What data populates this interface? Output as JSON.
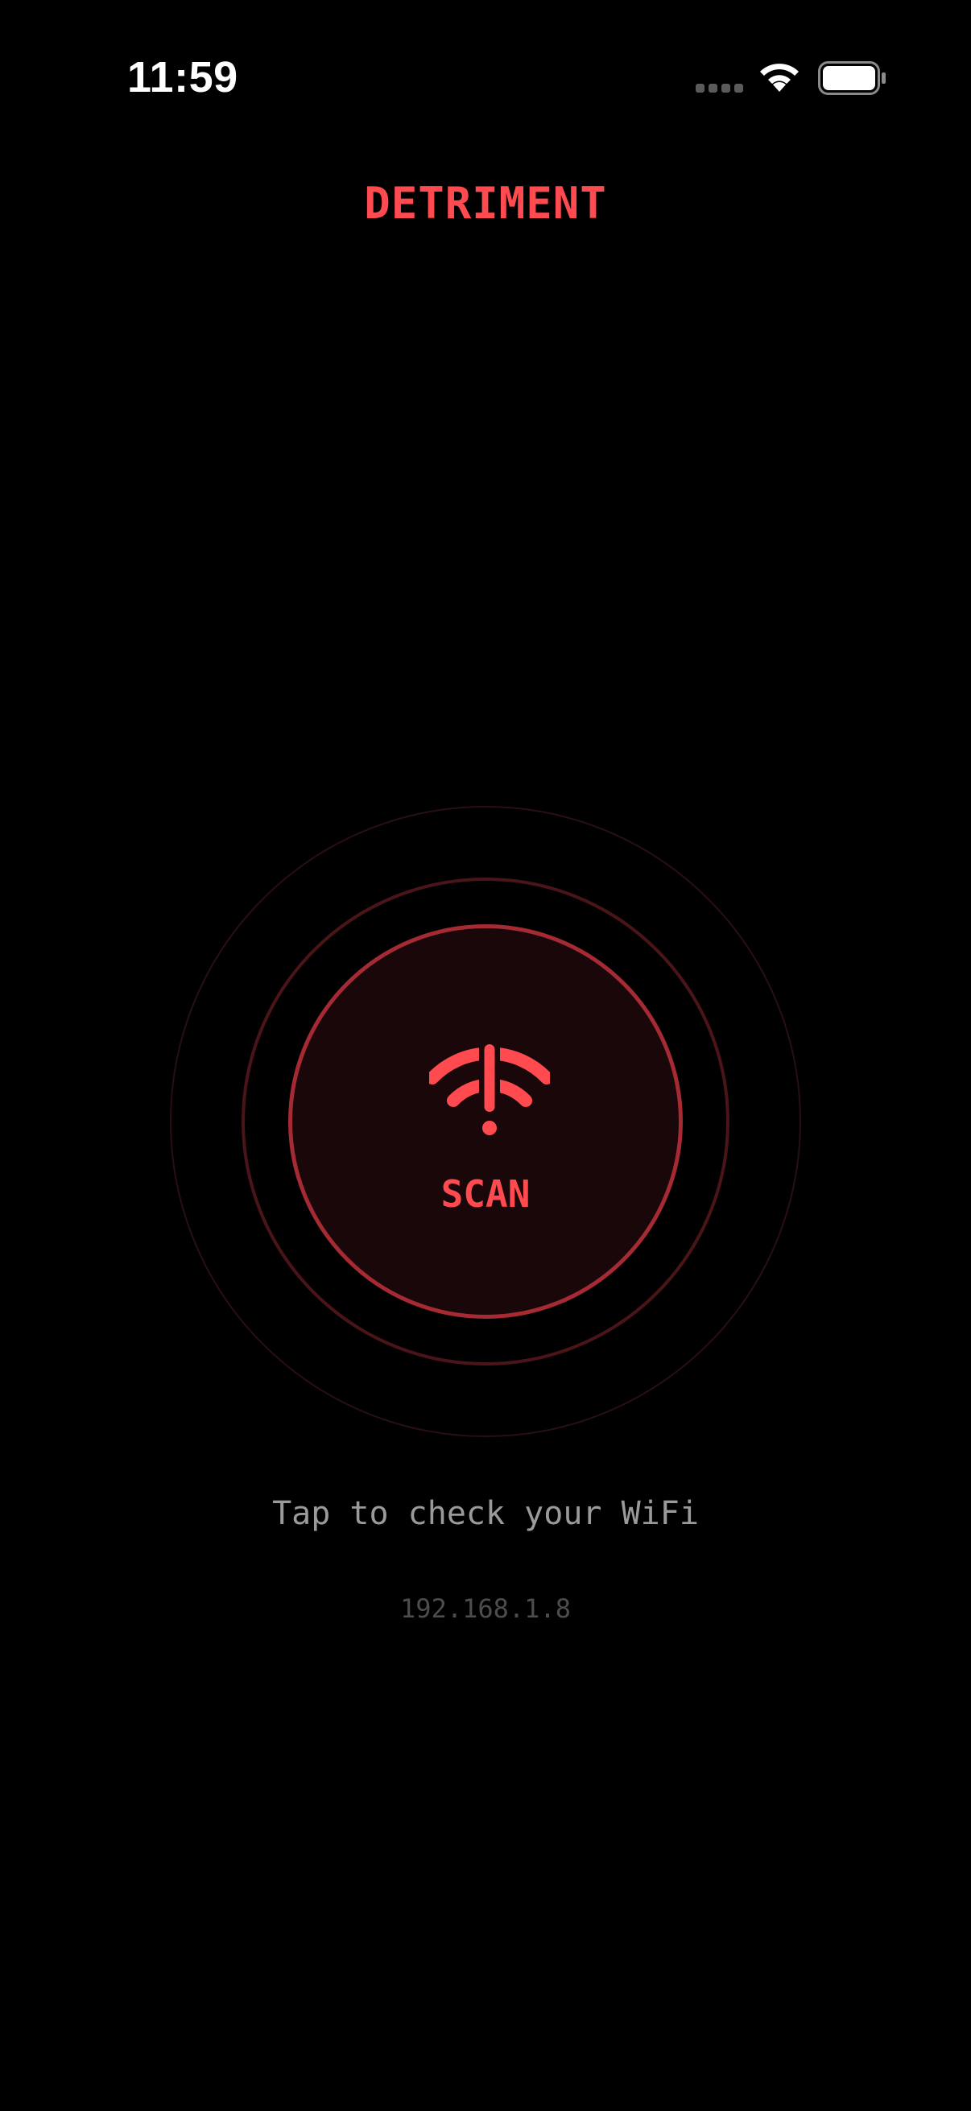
{
  "status_bar": {
    "time": "11:59",
    "icons": [
      "signal-dots-icon",
      "wifi-icon",
      "battery-icon"
    ]
  },
  "header": {
    "title": "DETRIMENT"
  },
  "scan": {
    "button_label": "SCAN",
    "icon": "wifi-alert-icon",
    "hint": "Tap to check your WiFi",
    "ip_address": "192.168.1.8"
  },
  "colors": {
    "background": "#000000",
    "accent": "#ff4b4f",
    "button_border": "#a52a33",
    "button_fill": "#1a0709",
    "hint_text": "#9a9a9a",
    "ip_text": "#4d4d4d"
  }
}
